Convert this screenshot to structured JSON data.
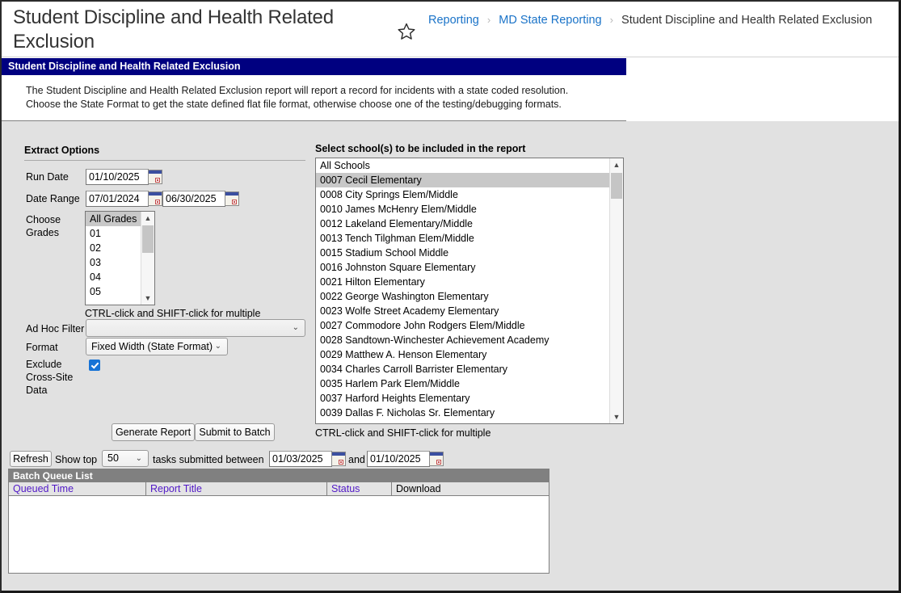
{
  "header": {
    "title": "Student Discipline and Health Related Exclusion",
    "star_icon": "star-outline-icon",
    "breadcrumb": {
      "item1": "Reporting",
      "item2": "MD State Reporting",
      "current": "Student Discipline and Health Related Exclusion",
      "separator": "›"
    }
  },
  "section": {
    "bar_title": "Student Discipline and Health Related Exclusion",
    "description": "The Student Discipline and Health Related Exclusion report will report a record for incidents with a state coded resolution. Choose the State Format to get the state defined flat file format, otherwise choose one of the testing/debugging formats."
  },
  "extract_options": {
    "heading": "Extract Options",
    "run_date_label": "Run Date",
    "run_date_value": "01/10/2025",
    "date_range_label": "Date Range",
    "date_range_start": "07/01/2024",
    "date_range_end": "06/30/2025",
    "choose_grades_label": "Choose Grades",
    "grades": [
      "All Grades",
      "01",
      "02",
      "03",
      "04",
      "05"
    ],
    "grades_selected": "All Grades",
    "grades_hint": "CTRL-click and SHIFT-click for multiple",
    "ad_hoc_filter_label": "Ad Hoc Filter",
    "ad_hoc_filter_value": "",
    "format_label": "Format",
    "format_value": "Fixed Width (State Format)",
    "exclude_label": "Exclude Cross-Site Data",
    "exclude_checked": true,
    "generate_button": "Generate Report",
    "submit_button": "Submit to Batch",
    "chevron": "⌄"
  },
  "schools": {
    "heading": "Select school(s) to be included in the report",
    "hint": "CTRL-click and SHIFT-click for multiple",
    "selected": "0007 Cecil Elementary",
    "items": [
      "All Schools",
      "0007 Cecil Elementary",
      "0008 City Springs Elem/Middle",
      "0010 James McHenry Elem/Middle",
      "0012 Lakeland Elementary/Middle",
      "0013 Tench Tilghman Elem/Middle",
      "0015 Stadium School Middle",
      "0016 Johnston Square Elementary",
      "0021 Hilton Elementary",
      "0022 George Washington Elementary",
      "0023 Wolfe Street Academy Elementary",
      "0027 Commodore John Rodgers Elem/Middle",
      "0028 Sandtown-Winchester Achievement Academy",
      "0029 Matthew A. Henson Elementary",
      "0034 Charles Carroll Barrister Elementary",
      "0035 Harlem Park Elem/Middle",
      "0037 Harford Heights Elementary",
      "0039 Dallas F. Nicholas Sr. Elementary"
    ]
  },
  "batch_controls": {
    "refresh_button": "Refresh",
    "show_top_label": "Show top",
    "show_top_value": "50",
    "between_label": "tasks submitted between",
    "date_from": "01/03/2025",
    "and_label": "and",
    "date_to": "01/10/2025"
  },
  "batch_queue": {
    "title": "Batch Queue List",
    "columns": [
      "Queued Time",
      "Report Title",
      "Status",
      "Download"
    ],
    "rows": []
  }
}
